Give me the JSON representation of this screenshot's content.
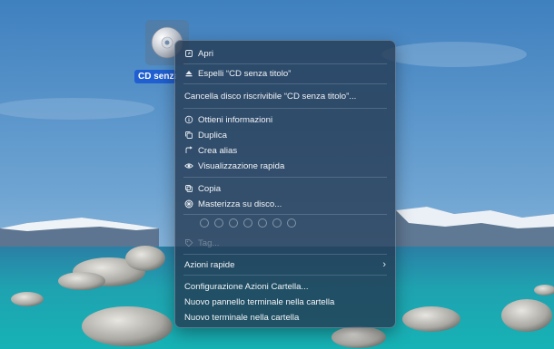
{
  "desktop": {
    "cd_icon": {
      "icon": "cd-disc-icon",
      "label": "CD senza titolo"
    }
  },
  "menu": {
    "open": "Apri",
    "eject": "Espelli “CD senza titolo”",
    "erase": "Cancella disco riscrivibile “CD senza titolo”...",
    "get_info": "Ottieni informazioni",
    "duplicate": "Duplica",
    "make_alias": "Crea alias",
    "quick_look": "Visualizzazione rapida",
    "copy": "Copia",
    "burn": "Masterizza su disco...",
    "tags": "Tag...",
    "quick_actions": "Azioni rapide",
    "folder_actions_setup": "Configurazione Azioni Cartella...",
    "new_terminal_tab": "Nuovo pannello terminale nella cartella",
    "new_terminal": "Nuovo terminale nella cartella"
  }
}
